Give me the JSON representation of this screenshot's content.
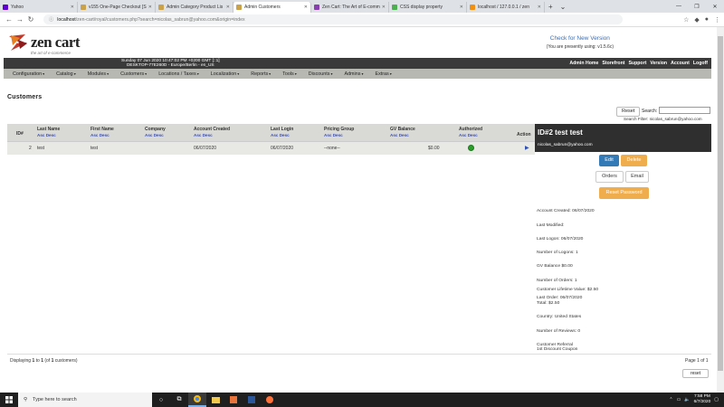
{
  "browser": {
    "tabs": [
      {
        "label": "Yahoo",
        "color": "#6001d2"
      },
      {
        "label": "v155 One-Page Checkout [S",
        "color": "#c9a24a"
      },
      {
        "label": "Admin Category Product Lis",
        "color": "#c9a24a"
      },
      {
        "label": "Admin Customers",
        "color": "#c9a24a",
        "active": true
      },
      {
        "label": "Zen Cart: The Art of E-comm",
        "color": "#8a3fb0"
      },
      {
        "label": "CSS display property",
        "color": "#4caf50"
      },
      {
        "label": "localhost / 127.0.0.1 / zen",
        "color": "#f29111"
      }
    ],
    "url_host": "localhost",
    "url_path": "/zen-cart/royal/customers.php?search=nicolas_sabrun@yahoo.com&origin=index"
  },
  "header": {
    "logo_text": "zen cart",
    "logo_sub": "the art of e-commerce",
    "check_version": "Check for New Version",
    "version_text": "(You are presently using: v1.5.6c)",
    "datetime_line1": "Sunday 07 Jun 2020 10:47:02 PM +0200 GMT [::1]",
    "datetime_line2": "DESKTOP-77E260D - Europe/Berlin - en_US",
    "top_links": [
      "Admin Home",
      "Storefront",
      "Support",
      "Version",
      "Account",
      "Logoff"
    ]
  },
  "menu": [
    "Configuration",
    "Catalog",
    "Modules",
    "Customers",
    "Locations / Taxes",
    "Localization",
    "Reports",
    "Tools",
    "Discounts",
    "Admins",
    "Extras"
  ],
  "page_title": "Customers",
  "search": {
    "reset_label": "Reset",
    "label": "Search:",
    "value": "",
    "filter": "Search Filter: nicolas_sabrun@yahoo.com"
  },
  "table": {
    "headers": {
      "id": "ID#",
      "last_name": "Last Name",
      "first_name": "First Name",
      "company": "Company",
      "account_created": "Account Created",
      "last_login": "Last Login",
      "pricing_group": "Pricing Group",
      "gv_balance": "GV Balance",
      "authorized": "Authorized",
      "action": "Action"
    },
    "sort_asc": "Asc",
    "sort_desc": "Desc",
    "row": {
      "id": "2",
      "last_name": "test",
      "first_name": "test",
      "company": "",
      "account_created": "06/07/2020",
      "last_login": "06/07/2020",
      "pricing_group": "--none--",
      "gv_balance": "$0.00",
      "action": "▶"
    }
  },
  "panel": {
    "title": "ID#2 test test",
    "email": "nicolas_sabrun@yahoo.com",
    "buttons": {
      "edit": "Edit",
      "delete": "Delete",
      "orders": "Orders",
      "email": "Email",
      "reset_password": "Reset Password"
    },
    "info": {
      "created": "Account Created: 06/07/2020",
      "modified": "Last Modified:",
      "last_logon": "Last Logon: 06/07/2020",
      "logons": "Number of Logons: 1",
      "gv": "GV Balance $0.00",
      "orders": "Number of Orders: 1",
      "lifetime": "Customer Lifetime Value: $2.50",
      "last_order": "Last Order: 06/07/2020",
      "total": "Total: $2.50",
      "country": "Country: United States",
      "reviews": "Number of Reviews: 0",
      "referral": "Customer Referral",
      "coupon": "1st Discount Coupon"
    }
  },
  "footer": {
    "displaying_pre": "Displaying ",
    "displaying_from": "1",
    "displaying_mid": " to ",
    "displaying_to": "1",
    "displaying_post": " (of ",
    "displaying_total": "1",
    "displaying_end": " customers)",
    "page_of": "Page 1 of 1",
    "reset_label": "reset"
  },
  "taskbar": {
    "search_placeholder": "Type here to search",
    "time": "7:58 PM",
    "date": "6/7/2020"
  }
}
